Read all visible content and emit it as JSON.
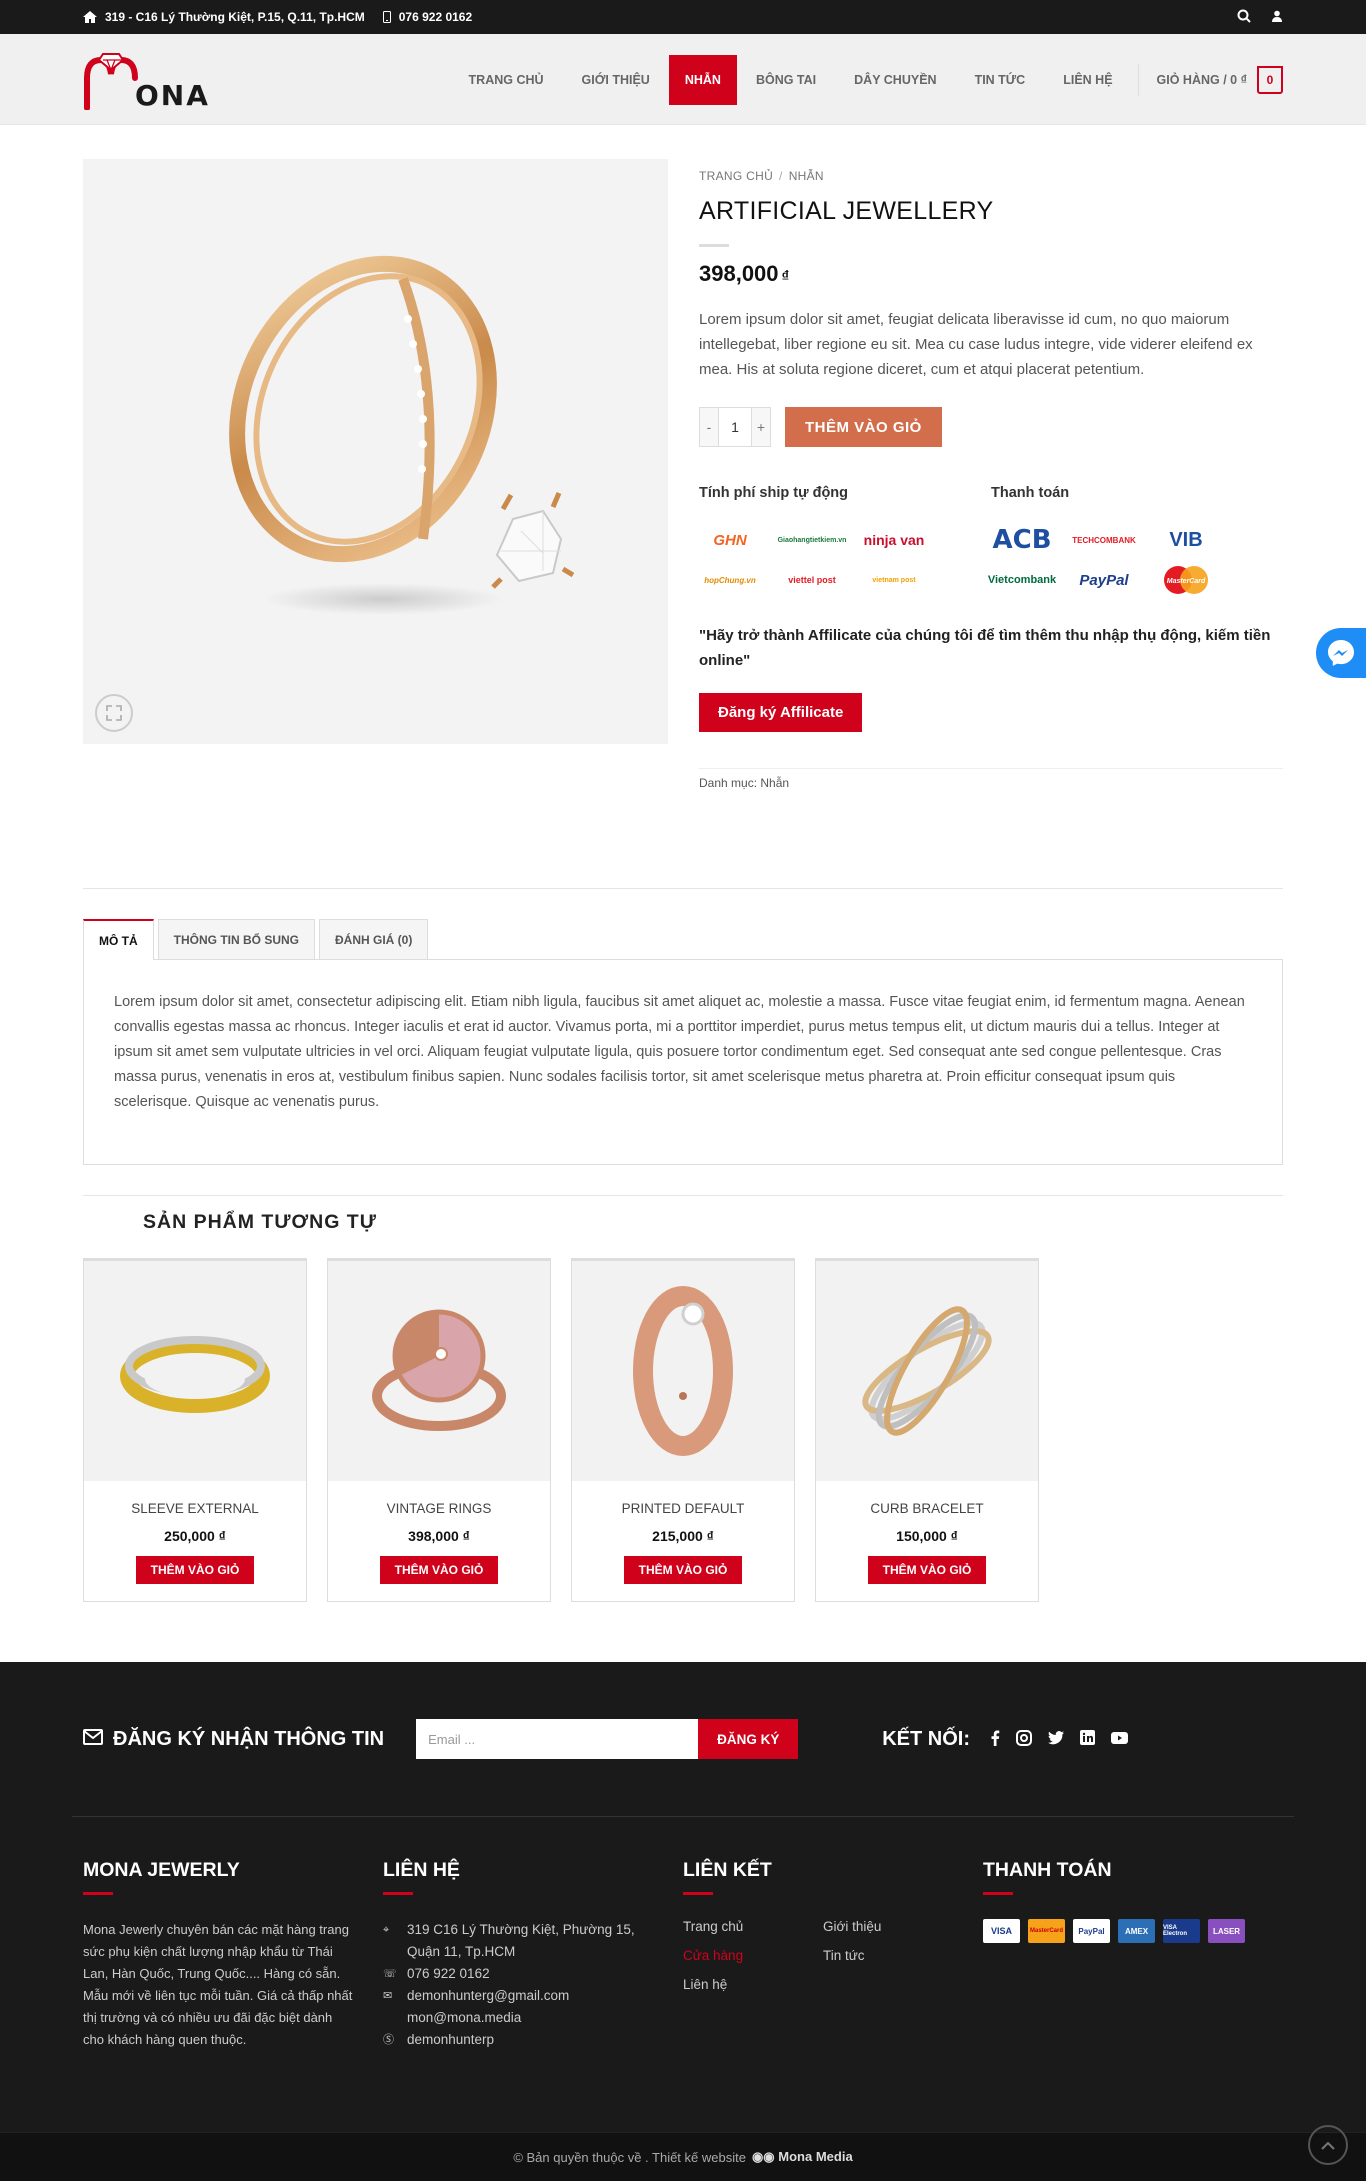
{
  "topbar": {
    "address": "319 - C16 Lý Thường Kiệt, P.15, Q.11, Tp.HCM",
    "phone": "076 922 0162"
  },
  "header": {
    "logo_text": "ONA",
    "nav": [
      "TRANG CHỦ",
      "GIỚI THIỆU",
      "NHẪN",
      "BÔNG TAI",
      "DÂY CHUYỀN",
      "TIN TỨC",
      "LIÊN HỆ"
    ],
    "active_nav": "NHẪN",
    "cart_label": "GIỎ HÀNG / 0 ₫",
    "cart_count": "0"
  },
  "product": {
    "breadcrumb": [
      "TRANG CHỦ",
      "NHẪN"
    ],
    "title": "ARTIFICIAL JEWELLERY",
    "price": "398,000",
    "currency": "₫",
    "short_description": "Lorem ipsum dolor sit amet, feugiat delicata liberavisse id cum, no quo maiorum intellegebat, liber regione eu sit. Mea cu case ludus integre, vide viderer eleifend ex mea. His at soluta regione diceret, cum et atqui placerat petentium.",
    "qty_minus": "-",
    "qty_value": "1",
    "qty_plus": "+",
    "add_to_cart": "THÊM VÀO GIỎ",
    "shipping_title": "Tính phí ship tự động",
    "payment_title": "Thanh toán",
    "shipping_logos": [
      "GHN",
      "Giaohangtietkiem.vn",
      "ninja van",
      "hopChung.vn",
      "viettel post",
      "vietnam post"
    ],
    "payment_logos": [
      "ACB",
      "TECHCOMBANK",
      "VIB",
      "Vietcombank",
      "PayPal",
      "MasterCard"
    ],
    "affiliate_text": "\"Hãy trở thành Affilicate của chúng tôi để tìm thêm thu nhập thụ động, kiếm tiền online\"",
    "affiliate_button": "Đăng ký Affilicate",
    "category_label": "Danh mục:",
    "category_value": "Nhẫn"
  },
  "tabs": {
    "items": [
      "MÔ TẢ",
      "THÔNG TIN BỔ SUNG",
      "ĐÁNH GIÁ (0)"
    ],
    "active": "MÔ TẢ",
    "description": "Lorem ipsum dolor sit amet, consectetur adipiscing elit. Etiam nibh ligula, faucibus sit amet aliquet ac, molestie a massa. Fusce vitae feugiat enim, id fermentum magna. Aenean convallis egestas massa ac rhoncus. Integer iaculis et erat id auctor. Vivamus porta, mi a porttitor imperdiet, purus metus tempus elit, ut dictum mauris dui a tellus. Integer at ipsum sit amet sem vulputate ultricies in vel orci. Aliquam feugiat vulputate ligula, quis posuere tortor condimentum eget. Sed consequat ante sed congue pellentesque. Cras massa purus, venenatis in eros at, vestibulum finibus sapien. Nunc sodales facilisis tortor, sit amet scelerisque metus pharetra at. Proin efficitur consequat ipsum quis scelerisque. Quisque ac venenatis purus."
  },
  "related": {
    "title": "SẢN PHẨM TƯƠNG TỰ",
    "button": "THÊM VÀO GIỎ",
    "items": [
      {
        "name": "SLEEVE EXTERNAL",
        "price": "250,000 ₫"
      },
      {
        "name": "VINTAGE RINGS",
        "price": "398,000 ₫"
      },
      {
        "name": "PRINTED DEFAULT",
        "price": "215,000 ₫"
      },
      {
        "name": "CURB BRACELET",
        "price": "150,000 ₫"
      }
    ]
  },
  "footer": {
    "newsletter_title": "ĐĂNG KÝ NHẬN THÔNG TIN",
    "email_placeholder": "Email ...",
    "subscribe": "ĐĂNG KÝ",
    "connect": "KẾT NỐI:",
    "about_title": "MONA JEWERLY",
    "about_text": "Mona Jewerly chuyên bán các mặt hàng trang sức phụ kiện chất lượng nhập khẩu từ Thái Lan, Hàn Quốc, Trung Quốc.... Hàng có sẵn. Mẫu mới về liên tục mỗi tuần. Giá cả thấp nhất thị trường và có nhiều ưu đãi đặc biệt dành cho khách hàng quen thuộc.",
    "contact_title": "LIÊN HỆ",
    "contact": {
      "address": "319 C16 Lý Thường Kiệt, Phường 15, Quận 11, Tp.HCM",
      "phone": "076 922 0162",
      "email": "demonhunterg@gmail.com\nmon@mona.media",
      "skype": "demonhunterp"
    },
    "links_title": "LIÊN KẾT",
    "links": [
      "Trang chủ",
      "Giới thiệu",
      "Cửa hàng",
      "Tin tức",
      "Liên hệ"
    ],
    "pay_title": "THANH TOÁN",
    "cards": [
      "VISA",
      "MasterCard",
      "PayPal",
      "AMEX",
      "VISA Electron",
      "LASER"
    ],
    "copyright": "© Bản quyền thuộc về . Thiết kế website",
    "copyright_brand": "Mona Media"
  },
  "colors": {
    "accent": "#d0011b",
    "add_to_cart": "#d26e4b",
    "footer_bg": "#1a1a1a"
  }
}
